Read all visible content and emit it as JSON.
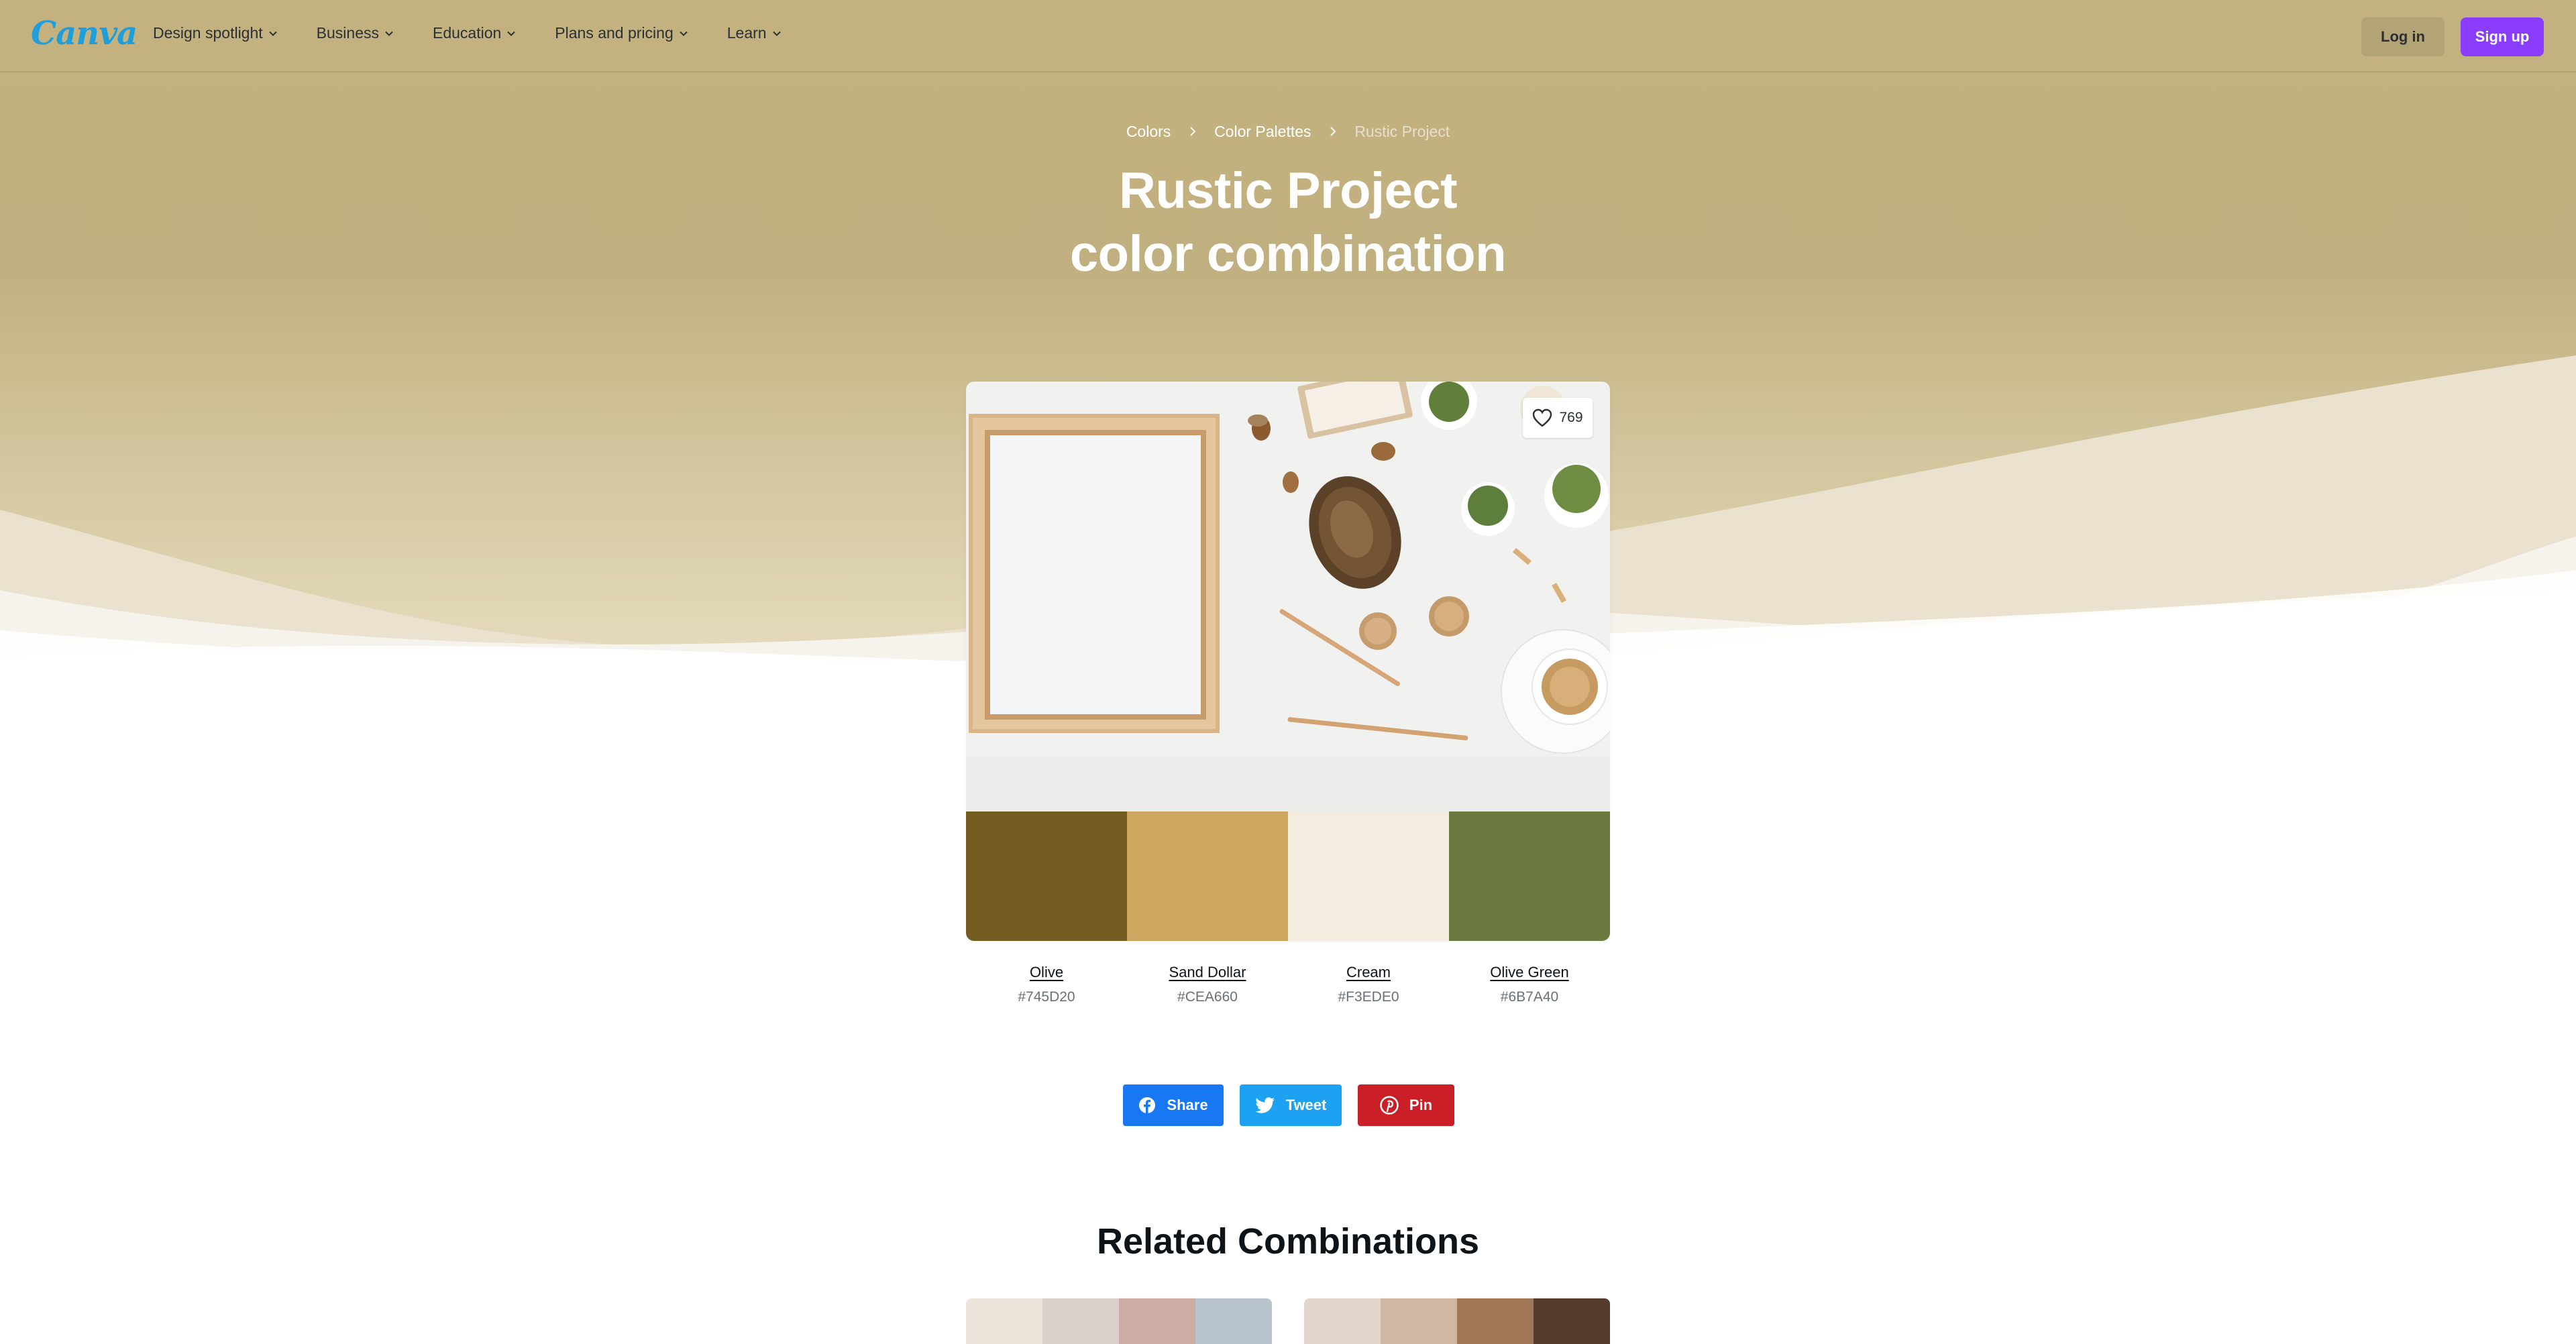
{
  "header": {
    "logo": "Canva",
    "nav": [
      {
        "label": "Design spotlight"
      },
      {
        "label": "Business"
      },
      {
        "label": "Education"
      },
      {
        "label": "Plans and pricing"
      },
      {
        "label": "Learn"
      }
    ],
    "login_label": "Log in",
    "signup_label": "Sign up"
  },
  "breadcrumb": {
    "items": [
      "Colors",
      "Color Palettes",
      "Rustic Project"
    ]
  },
  "title": {
    "line1": "Rustic Project",
    "line2": "color combination"
  },
  "likes": "769",
  "palette": [
    {
      "name": "Olive",
      "hex": "#745D20"
    },
    {
      "name": "Sand Dollar",
      "hex": "#CEA660"
    },
    {
      "name": "Cream",
      "hex": "#F3EDE0"
    },
    {
      "name": "Olive Green",
      "hex": "#6B7A40"
    }
  ],
  "share": {
    "facebook": "Share",
    "twitter": "Tweet",
    "pinterest": "Pin"
  },
  "related": {
    "title": "Related Combinations",
    "cards": [
      {
        "colors": [
          "#ECE5DB",
          "#DAD1CD",
          "#CBADA3",
          "#B8C3CE"
        ]
      },
      {
        "colors": [
          "#E3D5CA",
          "#D1B6A1",
          "#A07654",
          "#553C2C"
        ]
      }
    ]
  },
  "colors": {
    "accent": "#8B3DFF",
    "hero": "#C3B27F",
    "facebook": "#1877F2",
    "twitter": "#1DA1F2",
    "pinterest": "#CB1F27"
  }
}
